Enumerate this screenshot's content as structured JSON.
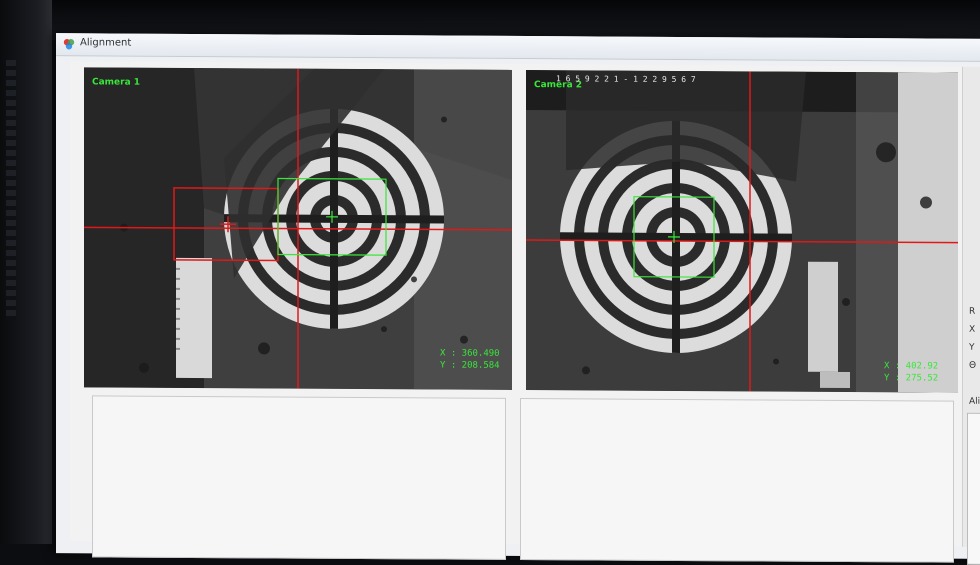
{
  "window": {
    "title": "Alignment"
  },
  "camera1": {
    "label": "Camera 1",
    "x_readout": "X : 360.490",
    "y_readout": "Y : 208.584"
  },
  "camera2": {
    "label": "Camera 2",
    "x_readout": "X : 402.92",
    "y_readout": "Y : 275.52",
    "scale_text": "1 6 5 9 2 2 1 - 1 2 2 9 5 6 7"
  },
  "side_panel": {
    "labels": [
      "R",
      "X",
      "Y",
      "Θ"
    ],
    "section_label": "Align"
  },
  "colors": {
    "overlay_green": "#39e639",
    "crosshair_red": "#e01818"
  }
}
